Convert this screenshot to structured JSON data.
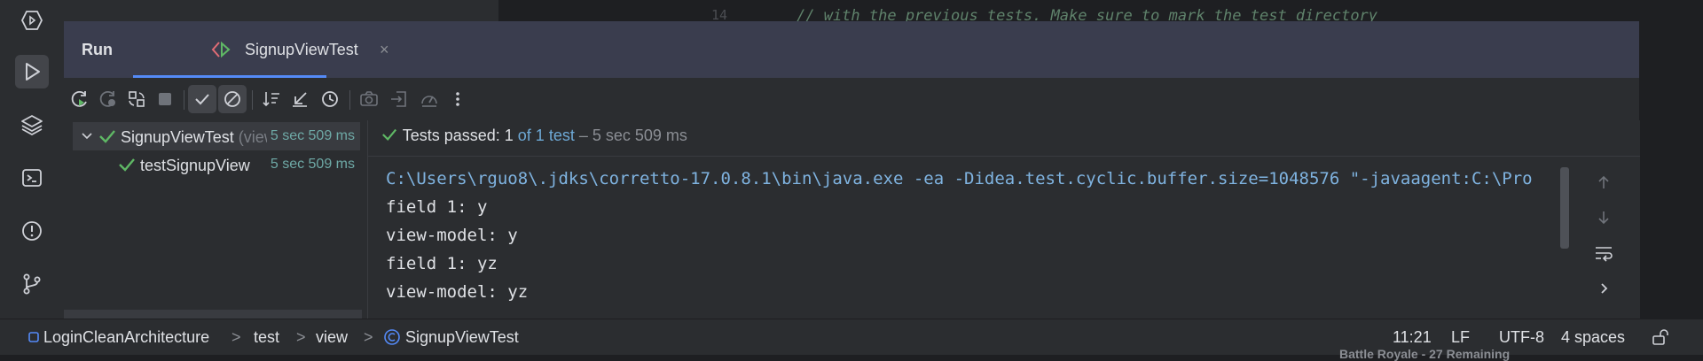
{
  "editor_peek": {
    "line_number": "14",
    "code_text": "//        with the previous tests. Make sure to mark the test directory"
  },
  "toolstrip": {
    "items": [
      {
        "name": "services-icon"
      },
      {
        "name": "run-icon",
        "active": true
      },
      {
        "name": "layers-icon"
      },
      {
        "name": "terminal-icon"
      },
      {
        "name": "problems-icon"
      },
      {
        "name": "git-icon"
      }
    ]
  },
  "run_panel": {
    "title": "Run",
    "tab": {
      "label": "SignupViewTest",
      "close": "×"
    }
  },
  "toolbar": {
    "buttons": [
      "rerun-icon",
      "rerun-failed-icon",
      "toggle-auto-test-icon",
      "stop-icon",
      "show-passed-icon",
      "show-ignored-icon",
      "sort-icon",
      "collapse-icon",
      "history-icon",
      "screenshot-icon",
      "export-icon",
      "coverage-icon",
      "more-icon"
    ]
  },
  "test_tree": {
    "root": {
      "name": "SignupViewTest",
      "scope": "(view",
      "time": "5 sec 509 ms"
    },
    "child": {
      "name": "testSignupView",
      "time": "5 sec 509 ms"
    }
  },
  "console": {
    "status": {
      "prefix": "Tests passed:",
      "count": "1",
      "of_total": "of 1 test",
      "duration": "– 5 sec 509 ms"
    },
    "lines": [
      "C:\\Users\\rguo8\\.jdks\\corretto-17.0.8.1\\bin\\java.exe -ea -Didea.test.cyclic.buffer.size=1048576 \"-javaagent:C:\\Pro",
      "field 1: y",
      "view-model: y",
      "field 1: yz",
      "view-model: yz"
    ]
  },
  "statusbar": {
    "breadcrumb": [
      "LoginCleanArchitecture",
      "test",
      "view",
      "SignupViewTest"
    ],
    "separator": ">",
    "position": "11:21",
    "line_ending": "LF",
    "encoding": "UTF-8",
    "indent": "4 spaces"
  },
  "bottom_peek_text": "Battle Royale - 27 Remaining",
  "colors": {
    "accent": "#548af7",
    "success": "#5fb865",
    "tab_bar": "#3a3d4e"
  }
}
